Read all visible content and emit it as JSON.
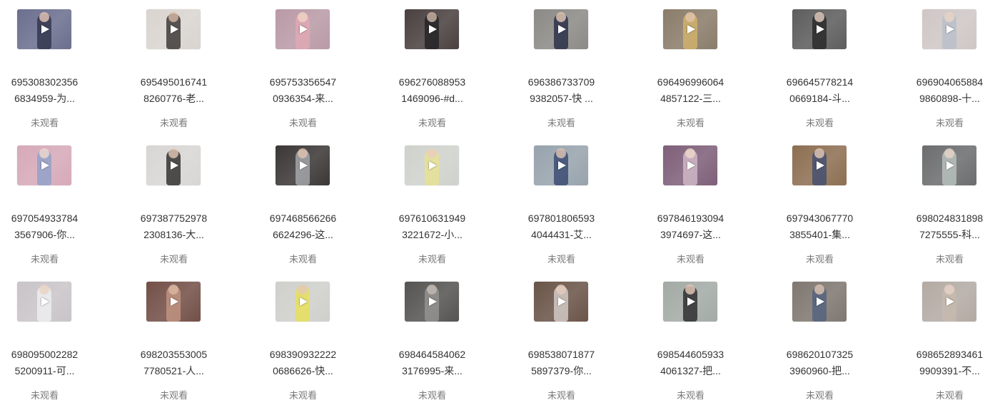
{
  "items": [
    {
      "line1": "695308302356",
      "line2": "6834959-为...",
      "status": "未观看",
      "bg": "#6b6f8e",
      "fig": "#2b2d44",
      "head": "#e8c8b8"
    },
    {
      "line1": "695495016741",
      "line2": "8260776-老...",
      "status": "未观看",
      "bg": "#d9d4cf",
      "fig": "#2a2624",
      "head": "#d8b9a5"
    },
    {
      "line1": "695753356547",
      "line2": "0936354-来...",
      "status": "未观看",
      "bg": "#b99aa6",
      "fig": "#e3a8b4",
      "head": "#f0d6c4"
    },
    {
      "line1": "696276088953",
      "line2": "1469096-#d...",
      "status": "未观看",
      "bg": "#4a4040",
      "fig": "#1d1d22",
      "head": "#cfb7a6"
    },
    {
      "line1": "696386733709",
      "line2": "9382057-快 ...",
      "status": "未观看",
      "bg": "#8c8a86",
      "fig": "#1e2440",
      "head": "#e6cbb7"
    },
    {
      "line1": "696496996064",
      "line2": "4857122-三...",
      "status": "未观看",
      "bg": "#8a7c6a",
      "fig": "#d8b66a",
      "head": "#e2c4ab"
    },
    {
      "line1": "696645778214",
      "line2": "0669184-斗...",
      "status": "未观看",
      "bg": "#5e5d5d",
      "fig": "#222222",
      "head": "#e8d2c3"
    },
    {
      "line1": "696904065884",
      "line2": "9860898-十...",
      "status": "未观看",
      "bg": "#cfc7c5",
      "fig": "#b6bdc9",
      "head": "#ead5c6"
    },
    {
      "line1": "697054933784",
      "line2": "3567906-你...",
      "status": "未观看",
      "bg": "#d6a9b9",
      "fig": "#8a9fc9",
      "head": "#f1d9ce"
    },
    {
      "line1": "697387752978",
      "line2": "2308136-大...",
      "status": "未观看",
      "bg": "#d8d6d4",
      "fig": "#1d1b1b",
      "head": "#e4c8b6"
    },
    {
      "line1": "697468566266",
      "line2": "6624296-这...",
      "status": "未观看",
      "bg": "#3b3736",
      "fig": "#aeb2b5",
      "head": "#e0c3b1"
    },
    {
      "line1": "697610631949",
      "line2": "3221672-小...",
      "status": "未观看",
      "bg": "#cfd2cc",
      "fig": "#e8e38c",
      "head": "#e8cdbb"
    },
    {
      "line1": "697801806593",
      "line2": "4044431-艾...",
      "status": "未观看",
      "bg": "#97a3ad",
      "fig": "#2d3f6b",
      "head": "#e2c7b4"
    },
    {
      "line1": "697846193094",
      "line2": "3974697-这...",
      "status": "未观看",
      "bg": "#7e5f79",
      "fig": "#d8c2cf",
      "head": "#efd8cc"
    },
    {
      "line1": "697943067770",
      "line2": "3855401-集...",
      "status": "未观看",
      "bg": "#8d6f52",
      "fig": "#3b4a72",
      "head": "#e6cab6"
    },
    {
      "line1": "698024831898",
      "line2": "7275555-科...",
      "status": "未观看",
      "bg": "#6b6d6e",
      "fig": "#bfcac6",
      "head": "#e8d3c6"
    },
    {
      "line1": "698095002282",
      "line2": "5200911-可...",
      "status": "未观看",
      "bg": "#c9c4c8",
      "fig": "#f2f2f4",
      "head": "#e9d2c2"
    },
    {
      "line1": "698203553005",
      "line2": "7780521-人...",
      "status": "未观看",
      "bg": "#735048",
      "fig": "#c99a86",
      "head": "#dbb9a2"
    },
    {
      "line1": "698390932222",
      "line2": "0686626-快...",
      "status": "未观看",
      "bg": "#cfcfcb",
      "fig": "#e9e24c",
      "head": "#e3c8b5"
    },
    {
      "line1": "698464584062",
      "line2": "3176995-来...",
      "status": "未观看",
      "bg": "#555452",
      "fig": "#9a9896",
      "head": "#c4bab3"
    },
    {
      "line1": "698538071877",
      "line2": "5897379-你...",
      "status": "未观看",
      "bg": "#6a5448",
      "fig": "#ded7d3",
      "head": "#e6cbbb"
    },
    {
      "line1": "698544605933",
      "line2": "4061327-把...",
      "status": "未观看",
      "bg": "#a3aaa5",
      "fig": "#1e1e22",
      "head": "#e7ccb9"
    },
    {
      "line1": "698620107325",
      "line2": "3960960-把...",
      "status": "未观看",
      "bg": "#7f7770",
      "fig": "#4d5f7f",
      "head": "#e2c5b1"
    },
    {
      "line1": "698652893461",
      "line2": "9909391-不...",
      "status": "未观看",
      "bg": "#b3aaa3",
      "fig": "#c8b9ae",
      "head": "#e6d2c5"
    }
  ]
}
